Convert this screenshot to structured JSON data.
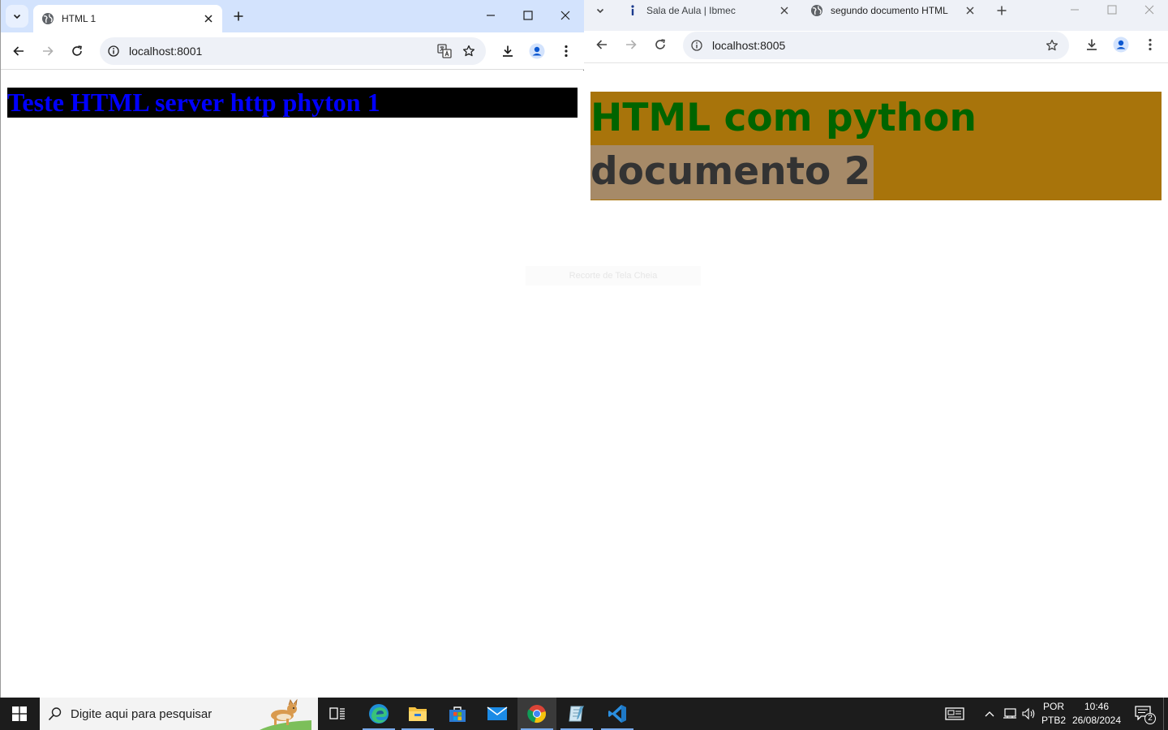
{
  "left_window": {
    "tab": {
      "title": "HTML 1"
    },
    "address": "localhost:8001",
    "page": {
      "heading": "Teste HTML server http phyton 1"
    }
  },
  "right_window": {
    "tabs": [
      {
        "title": "Sala de Aula | Ibmec"
      },
      {
        "title": "segundo documento HTML"
      }
    ],
    "address": "localhost:8005",
    "page": {
      "line1": "HTML com python",
      "line2": "documento 2"
    }
  },
  "overlay": {
    "snip_hint": "Recorte de Tela Cheia"
  },
  "taskbar": {
    "search_placeholder": "Digite aqui para pesquisar",
    "language": "POR",
    "layout": "PTB2",
    "time": "10:46",
    "date": "26/08/2024",
    "notification_count": "2"
  },
  "colors": {
    "active_tabstrip": "#d3e3fd",
    "page1_heading_bg": "#000000",
    "page1_heading_text": "#0000ff",
    "page2_block_bg": "#a8740b",
    "page2_line1_text": "#006400",
    "page2_line2_bg": "#a68a68",
    "taskbar_bg": "#1c1c1c"
  }
}
